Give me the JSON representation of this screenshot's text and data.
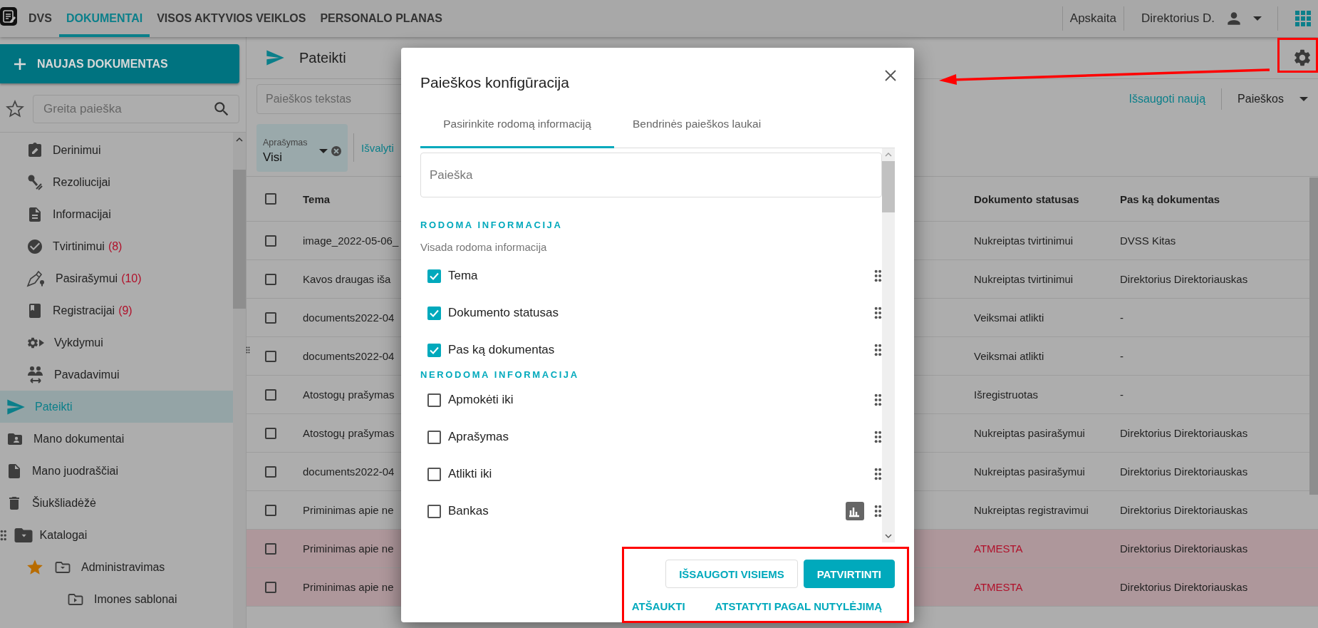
{
  "top_bar": {
    "tabs": [
      {
        "label": "DVS",
        "selected": false
      },
      {
        "label": "DOKUMENTAI",
        "selected": true
      },
      {
        "label": "VISOS AKTYVIOS VEIKLOS",
        "selected": false
      },
      {
        "label": "PERSONALO PLANAS",
        "selected": false
      }
    ],
    "module": "Apskaita",
    "user": "Direktorius D."
  },
  "sidebar": {
    "new_button": "NAUJAS DOKUMENTAS",
    "quick_search": {
      "placeholder": "Greita paieška"
    },
    "inbox_items": [
      {
        "label": "Derinimui",
        "selected": false
      },
      {
        "label": "Rezoliucijai",
        "selected": false
      },
      {
        "label": "Informacijai",
        "selected": false
      },
      {
        "label": "Tvirtinimui",
        "count": "(8)",
        "selected": false
      },
      {
        "label": "Pasirašymui",
        "count": "(10)",
        "selected": false
      },
      {
        "label": "Registracijai",
        "count": "(9)",
        "selected": false
      },
      {
        "label": "Vykdymui",
        "selected": false
      },
      {
        "label": "Pavadavimui",
        "selected": false
      }
    ],
    "items": [
      {
        "label": "Pateikti",
        "selected": true
      },
      {
        "label": "Mano dokumentai",
        "selected": false
      },
      {
        "label": "Mano juodraščiai",
        "selected": false
      },
      {
        "label": "Šiukšliadėžė",
        "selected": false
      },
      {
        "label": "Katalogai",
        "selected": false,
        "children": [
          {
            "label": "Administravimas",
            "favorite": true,
            "selected": false,
            "children": [
              {
                "label": "Imones sablonai",
                "favorite": false,
                "selected": false
              }
            ]
          }
        ]
      }
    ]
  },
  "main": {
    "title": "Pateikti",
    "search": {
      "placeholder": "Paieškos tekstas"
    },
    "save_new": "Išsaugoti naują",
    "searches": "Paieškos",
    "filter": {
      "label": "Aprašymas",
      "value": "Visi"
    },
    "clear": "Išvalyti",
    "table": {
      "columns": [
        "Tema",
        "Dokumento statusas",
        "Pas ką dokumentas"
      ],
      "header_checked": false,
      "rows": [
        {
          "tema": "image_2022-05-06_",
          "status": "Nukreiptas tvirtinimui",
          "owner": "DVSS Kitas",
          "checked": false,
          "rejected": false
        },
        {
          "tema": "Kavos draugas iša",
          "status": "Nukreiptas tvirtinimui",
          "owner": "Direktorius Direktoriauskas",
          "checked": false,
          "rejected": false
        },
        {
          "tema": "documents2022-04",
          "status": "Veiksmai atlikti",
          "owner": "-",
          "checked": false,
          "rejected": false
        },
        {
          "tema": "documents2022-04",
          "status": "Veiksmai atlikti",
          "owner": "-",
          "checked": false,
          "rejected": false
        },
        {
          "tema": "Atostogų prašymas",
          "status": "Išregistruotas",
          "owner": "-",
          "checked": false,
          "rejected": false
        },
        {
          "tema": "Atostogų prašymas",
          "status": "Nukreiptas pasirašymui",
          "owner": "Direktorius Direktoriauskas",
          "checked": false,
          "rejected": false
        },
        {
          "tema": "documents2022-04",
          "status": "Nukreiptas pasirašymui",
          "owner": "Direktorius Direktoriauskas",
          "checked": false,
          "rejected": false
        },
        {
          "tema": "Priminimas apie ne",
          "status": "Nukreiptas registravimui",
          "owner": "Direktorius Direktoriauskas",
          "checked": false,
          "rejected": false
        },
        {
          "tema": "Priminimas apie ne",
          "status": "ATMESTA",
          "owner": "Direktorius Direktoriauskas",
          "checked": false,
          "rejected": true
        },
        {
          "tema": "Priminimas apie ne",
          "status": "ATMESTA",
          "owner": "Direktorius Direktoriauskas",
          "checked": false,
          "rejected": true
        }
      ]
    }
  },
  "dialog": {
    "title": "Paieškos konfigūracija",
    "tabs": [
      {
        "label": "Pasirinkite rodomą informaciją",
        "selected": true
      },
      {
        "label": "Bendrinės paieškos laukai",
        "selected": false
      }
    ],
    "search": {
      "placeholder": "Paieška"
    },
    "sections": [
      {
        "heading": "RODOMA INFORMACIJA",
        "note": "Visada rodoma informacija",
        "fields": [
          {
            "label": "Tema",
            "checked": true,
            "stats": false
          },
          {
            "label": "Dokumento statusas",
            "checked": true,
            "stats": false
          },
          {
            "label": "Pas ką dokumentas",
            "checked": true,
            "stats": false
          }
        ]
      },
      {
        "heading": "NERODOMA INFORMACIJA",
        "fields": [
          {
            "label": "Apmokėti iki",
            "checked": false,
            "stats": false
          },
          {
            "label": "Aprašymas",
            "checked": false,
            "stats": false
          },
          {
            "label": "Atlikti iki",
            "checked": false,
            "stats": false
          },
          {
            "label": "Bankas",
            "checked": false,
            "stats": true
          }
        ]
      }
    ],
    "buttons": [
      {
        "label": "IŠSAUGOTI VISIEMS",
        "kind": "outlined"
      },
      {
        "label": "PATVIRTINTI",
        "kind": "primary"
      }
    ],
    "links": [
      {
        "label": "ATŠAUKTI"
      },
      {
        "label": "ATSTATYTI PAGAL NUTYLĖJIMĄ"
      }
    ]
  }
}
